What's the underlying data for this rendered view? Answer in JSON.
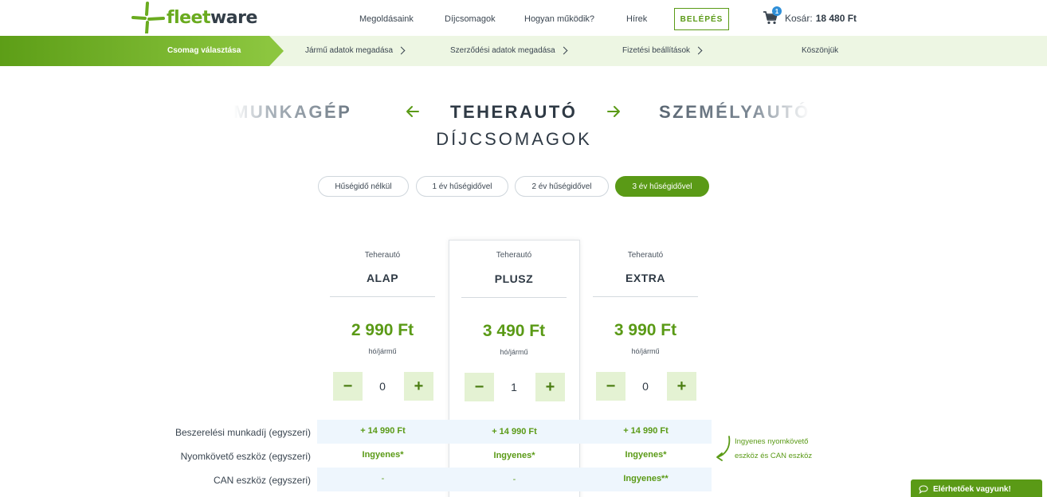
{
  "header": {
    "logo": {
      "part1": "fleet",
      "part2": "ware"
    },
    "nav": [
      "Megoldásaink",
      "Díjcsomagok",
      "Hogyan működik?",
      "Hírek"
    ],
    "login_label": "BELÉPÉS",
    "cart": {
      "badge": "1",
      "label": "Kosár:",
      "total": "18 480 Ft"
    }
  },
  "steps": [
    "Csomag választása",
    "Jármű adatok megadása",
    "Szerződési adatok megadása",
    "Fizetési beállítások",
    "Köszönjük"
  ],
  "categories": {
    "prev": "MUNKAGÉP",
    "current": "TEHERAUTÓ",
    "next": "SZEMÉLYAUTÓ"
  },
  "subtitle": "DÍJCSOMAGOK",
  "commitment": {
    "options": [
      "Hűségidő nélkül",
      "1 év hűségidővel",
      "2 év hűségidővel",
      "3 év hűségidővel"
    ],
    "selected": "3 év hűségidővel"
  },
  "packages": [
    {
      "type": "Teherautó",
      "name": "ALAP",
      "price": "2 990 Ft",
      "unit": "hó/jármű",
      "qty": "0"
    },
    {
      "type": "Teherautó",
      "name": "PLUSZ",
      "price": "3 490 Ft",
      "unit": "hó/jármű",
      "qty": "1"
    },
    {
      "type": "Teherautó",
      "name": "EXTRA",
      "price": "3 990 Ft",
      "unit": "hó/jármű",
      "qty": "0"
    }
  ],
  "features": [
    {
      "label": "Beszerelési munkadíj (egyszeri)",
      "values": [
        "+ 14 990 Ft",
        "+ 14 990 Ft",
        "+ 14 990 Ft"
      ]
    },
    {
      "label": "Nyomkövető eszköz (egyszeri)",
      "values": [
        "Ingyenes*",
        "Ingyenes*",
        "Ingyenes*"
      ]
    },
    {
      "label": "CAN eszköz (egyszeri)",
      "values": [
        "-",
        "-",
        "Ingyenes**"
      ]
    }
  ],
  "note": {
    "line1": "Ingyenes nyomkövető",
    "line2": "eszköz és CAN eszköz"
  },
  "chat_label": "Elérhetőek vagyunk!",
  "colors": {
    "brand_green": "#5a9a16",
    "light_green": "#8cc63f",
    "step_bg": "#edf6e3",
    "row_bg": "#eef6fd",
    "badge_blue": "#2f8fd8"
  }
}
